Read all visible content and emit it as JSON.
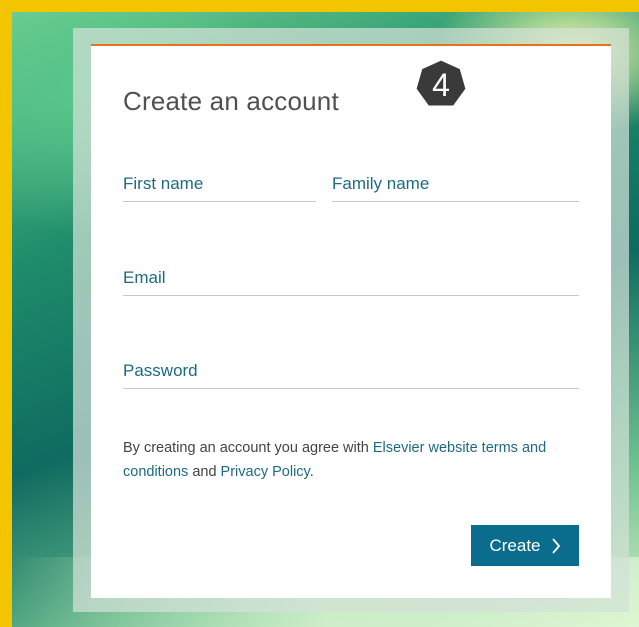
{
  "form": {
    "title": "Create an account",
    "step_badge": "4",
    "fields": {
      "first_name": {
        "label": "First name",
        "value": ""
      },
      "family_name": {
        "label": "Family name",
        "value": ""
      },
      "email": {
        "label": "Email",
        "value": ""
      },
      "password": {
        "label": "Password",
        "value": ""
      }
    },
    "terms": {
      "prefix": "By creating an account you agree with ",
      "terms_link": "Elsevier website terms and conditions",
      "middle": " and ",
      "privacy_link": "Privacy Policy",
      "suffix": "."
    },
    "create_label": "Create"
  },
  "colors": {
    "accent": "#e9711c",
    "link": "#1d6a80",
    "button": "#0b6d8d",
    "badge": "#3a3a3a"
  },
  "icons": {
    "button_icon": "chevron-right-icon",
    "badge_shape": "heptagon-badge"
  }
}
